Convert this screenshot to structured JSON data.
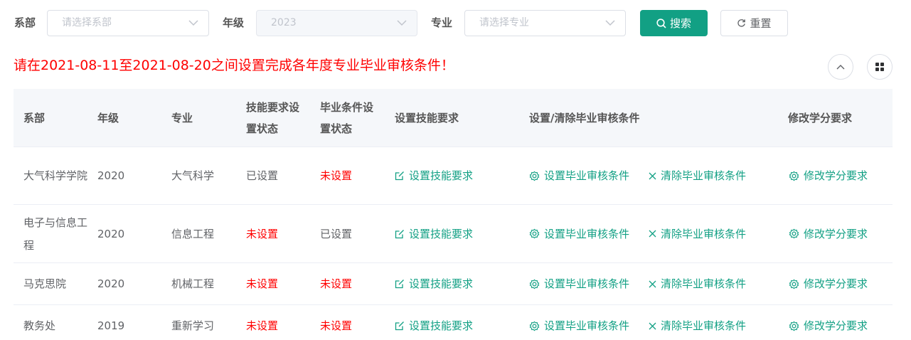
{
  "filters": {
    "dept_label": "系部",
    "dept_placeholder": "请选择系部",
    "grade_label": "年级",
    "grade_value": "2023",
    "major_label": "专业",
    "major_placeholder": "请选择专业",
    "search_label": "搜索",
    "reset_label": "重置"
  },
  "notice": "请在2021-08-11至2021-08-20之间设置完成各年度专业毕业审核条件！",
  "table": {
    "headers": {
      "dept": "系部",
      "grade": "年级",
      "major": "专业",
      "skill_status": "技能要求设置状态",
      "grad_status": "毕业条件设置状态",
      "set_skill": "设置技能要求",
      "set_clear": "设置/清除毕业审核条件",
      "edit_credit": "修改学分要求"
    },
    "actions": {
      "set_skill": "设置技能要求",
      "set_grad": "设置毕业审核条件",
      "clear_grad": "清除毕业审核条件",
      "edit_credit": "修改学分要求"
    },
    "rows": [
      {
        "dept": "大气科学学院",
        "grade": "2020",
        "major": "大气科学",
        "skill_status": "已设置",
        "grad_status": "未设置"
      },
      {
        "dept": "电子与信息工程",
        "grade": "2020",
        "major": "信息工程",
        "skill_status": "未设置",
        "grad_status": "已设置"
      },
      {
        "dept": "马克思院",
        "grade": "2020",
        "major": "机械工程",
        "skill_status": "未设置",
        "grad_status": "未设置"
      },
      {
        "dept": "教务处",
        "grade": "2019",
        "major": "重新学习",
        "skill_status": "未设置",
        "grad_status": "未设置"
      }
    ]
  },
  "colors": {
    "primary": "#12a084",
    "alert": "#ff0000",
    "header_bg": "#f5f7fa"
  }
}
